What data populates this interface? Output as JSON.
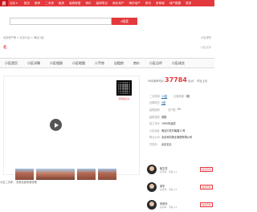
{
  "nav": {
    "logo": "房",
    "city": "北京",
    "items": [
      "首页",
      "新房",
      "二手房",
      "租房",
      "装修家居",
      "房价",
      "装修笔记",
      "商业地产",
      "海外地产",
      "资讯",
      "房商城",
      "地产数据",
      "更多"
    ]
  },
  "search": {
    "placeholder": "",
    "button": "搜索"
  },
  "breadcrumb": "北京房产网 > 北京小区 > 海淀小区",
  "right_links": "小区详情",
  "community": {
    "name": "北",
    "right": "小区点评"
  },
  "tabs": [
    "小区首页",
    "小区详情",
    "小区相册",
    "小区地图",
    "二手房",
    "出租房",
    "房价",
    "小区点评",
    "小区成交"
  ],
  "qr_label": "扫码看房价",
  "price": {
    "label": "09月参考均价",
    "value": "37784",
    "unit": "元/㎡",
    "change": "环比上月"
  },
  "info": [
    {
      "k": "二手房源",
      "v": "13套",
      "link": true,
      "k2": "出租房源",
      "v2": "3套"
    },
    {
      "k": "近期成交",
      "v": "0套",
      "link": true
    },
    {
      "k": "建筑面积",
      "v": "",
      "k2": "总户数",
      "v2": "74"
    },
    {
      "k": "建筑类型",
      "v": "塔楼"
    },
    {
      "k": "竣工年代",
      "v": "1990年建成"
    },
    {
      "k": "小区地址",
      "v": "海淀中关村南路11号"
    },
    {
      "k": "物业公司",
      "v": "北京和鸿物业管理有限公司"
    },
    {
      "k": "开发商",
      "v": "北京实业"
    }
  ],
  "footer_note": "小区二手房 ，查看全部房源攻略",
  "agents": [
    {
      "name": "姚文芳",
      "sub": "好评率 · 带看 13",
      "btn": "在线咨询"
    },
    {
      "name": "郭宇",
      "sub": "好评率 · 带看 13",
      "btn": "在线咨询"
    },
    {
      "name": "朱婷玲",
      "sub": "好评率 · 带看 13",
      "btn": "在线咨询"
    }
  ]
}
